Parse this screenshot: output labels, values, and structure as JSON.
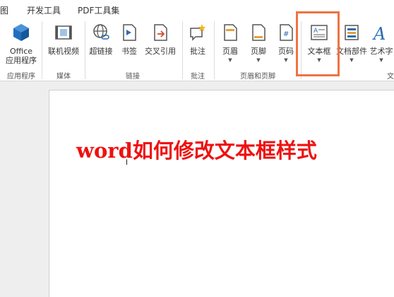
{
  "tabs": [
    "图",
    "开发工具",
    "PDF工具集"
  ],
  "ribbon": {
    "buttons": {
      "office": "Office\n应用程序",
      "video": "联机视频",
      "hyperlink": "超链接",
      "bookmark": "书签",
      "crossref": "交叉引用",
      "comment": "批注",
      "header": "页眉",
      "footer": "页脚",
      "pagenum": "页码",
      "textbox": "文本框",
      "docparts": "文档部件",
      "wordart": "艺术字"
    },
    "groups": {
      "apps": "应用程序",
      "media": "媒体",
      "links": "链接",
      "comments": "批注",
      "header_footer": "页眉和页脚",
      "text": "文"
    }
  },
  "document": {
    "overlay_title": "word如何修改文本框样式"
  },
  "colors": {
    "highlight": "#ee7342",
    "overlay_text": "#ee1111",
    "office_icon": "#1f6fc0"
  }
}
